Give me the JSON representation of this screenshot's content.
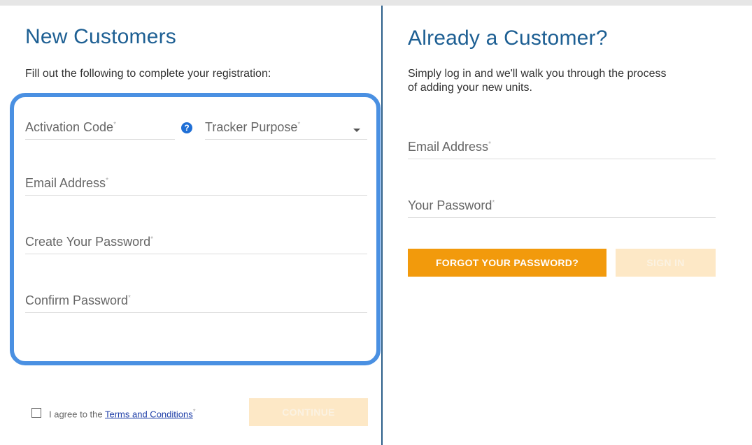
{
  "new_customers": {
    "title": "New Customers",
    "subtitle": "Fill out the following to complete your registration:",
    "fields": {
      "activation_code": "Activation Code",
      "tracker_purpose": "Tracker Purpose",
      "email": "Email Address",
      "create_password": "Create Your Password",
      "confirm_password": "Confirm Password"
    },
    "required_mark": "*",
    "help_icon": "?",
    "agree_prefix": "I agree to the ",
    "terms_link": "Terms and Conditions",
    "continue_label": "CONTINUE"
  },
  "existing_customer": {
    "title": "Already a Customer?",
    "subtitle_line1": "Simply log in and we'll walk you through the process",
    "subtitle_line2": "of adding your new units.",
    "fields": {
      "email": "Email Address",
      "password": "Your Password"
    },
    "forgot_label": "FORGOT YOUR PASSWORD?",
    "signin_label": "SIGN IN"
  },
  "colors": {
    "heading": "#1d5f93",
    "highlight": "#4a90e2",
    "orange": "#f29a0c",
    "disabled": "#fde8c6",
    "link": "#1f3fa8"
  }
}
